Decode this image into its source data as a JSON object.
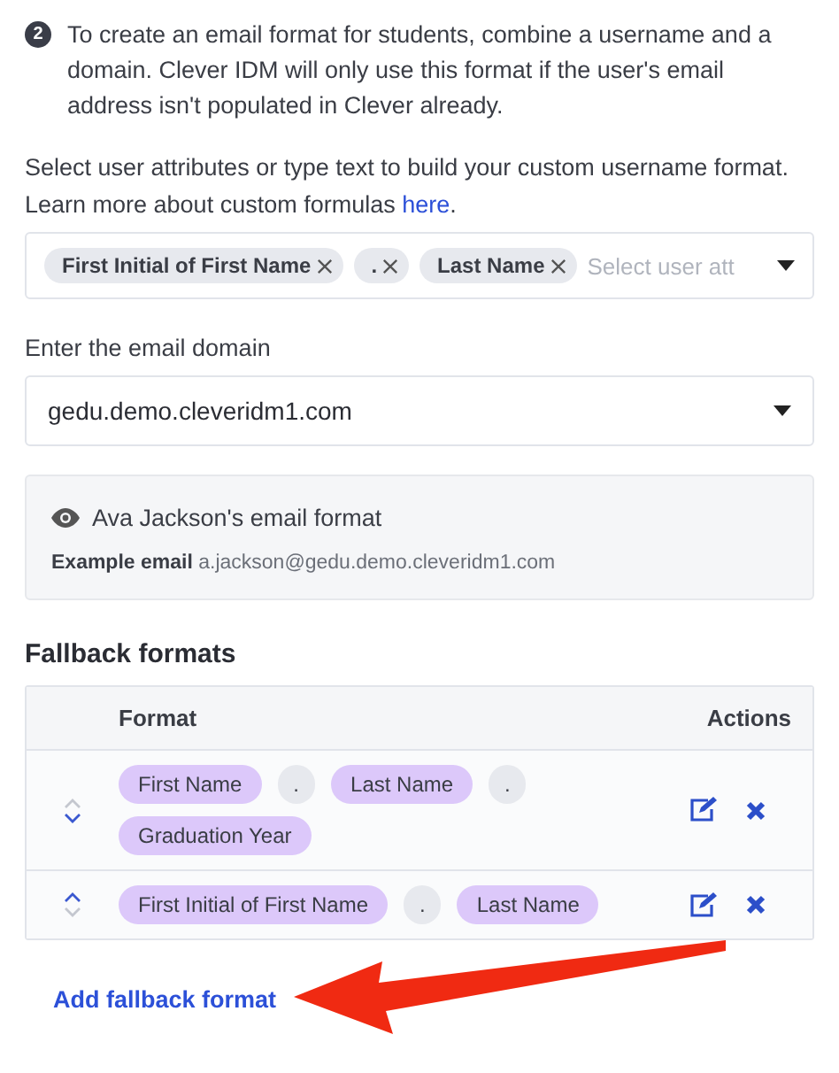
{
  "step": {
    "number": "2",
    "text": "To create an email format for students, combine a username and a domain. Clever IDM will only use this format if the user's email address isn't populated in Clever already."
  },
  "username": {
    "help": "Select user attributes or type text to build your custom username format. Learn more about custom formulas",
    "link": "here",
    "after_link": ".",
    "tokens": [
      "First Initial of First Name",
      ".",
      "Last Name"
    ],
    "placeholder": "Select user att"
  },
  "domain": {
    "label": "Enter the email domain",
    "value": "gedu.demo.cleveridm1.com"
  },
  "preview": {
    "title": "Ava Jackson's email format",
    "example_label": "Example email",
    "example_value": "a.jackson@gedu.demo.cleveridm1.com"
  },
  "fallback": {
    "title": "Fallback formats",
    "columns": [
      "Format",
      "Actions"
    ],
    "rows": [
      {
        "can_move_up": false,
        "can_move_down": true,
        "tokens": [
          {
            "kind": "attribute",
            "text": "First Name"
          },
          {
            "kind": "text",
            "text": "."
          },
          {
            "kind": "attribute",
            "text": "Last Name"
          },
          {
            "kind": "text",
            "text": "."
          },
          {
            "kind": "attribute",
            "text": "Graduation Year"
          }
        ]
      },
      {
        "can_move_up": true,
        "can_move_down": false,
        "tokens": [
          {
            "kind": "attribute",
            "text": "First Initial of First Name"
          },
          {
            "kind": "text",
            "text": "."
          },
          {
            "kind": "attribute",
            "text": "Last Name"
          }
        ]
      }
    ],
    "add_link": "Add fallback format"
  }
}
